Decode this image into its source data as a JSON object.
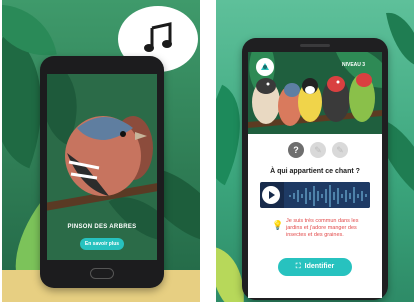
{
  "left": {
    "bird_name": "PINSON DES ARBRES",
    "more_button": "En savoir plus",
    "note_icon": "music-note-icon"
  },
  "right": {
    "level_label": "NIVEAU 3",
    "question": "À qui appartient ce chant ?",
    "hint": "Je suis très commun dans les jardins et j'adore manger des insectes et des graines.",
    "identify_button": "Identifier",
    "play_icon": "play-icon",
    "colors": {
      "accent": "#27c2bf",
      "hint_red": "#e24a4a",
      "waveform_bg": "#172a4a"
    }
  }
}
